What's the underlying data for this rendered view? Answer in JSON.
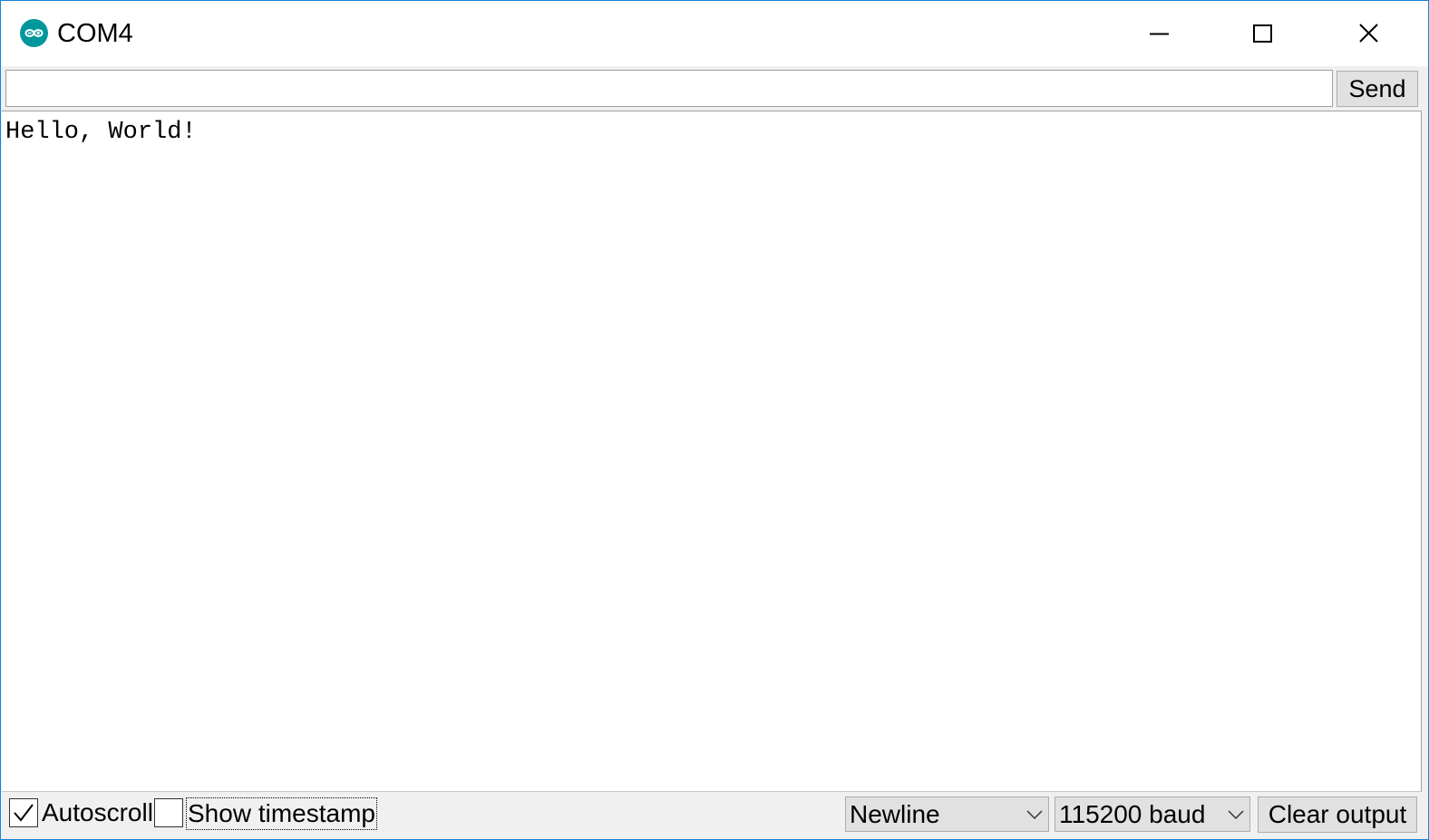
{
  "window": {
    "title": "COM4",
    "accent_color": "#1883d7",
    "app_icon": "arduino-icon"
  },
  "caption_buttons": {
    "minimize_icon": "minimize-icon",
    "maximize_icon": "maximize-icon",
    "close_icon": "close-icon"
  },
  "send_row": {
    "input_value": "",
    "input_placeholder": "",
    "send_label": "Send"
  },
  "output": {
    "lines": [
      "Hello, World!"
    ]
  },
  "bottom_bar": {
    "autoscroll_label": "Autoscroll",
    "autoscroll_checked": true,
    "timestamp_label": "Show timestamp",
    "timestamp_checked": false,
    "line_ending_selected": "Newline",
    "baud_selected": "115200 baud",
    "clear_label": "Clear output"
  }
}
